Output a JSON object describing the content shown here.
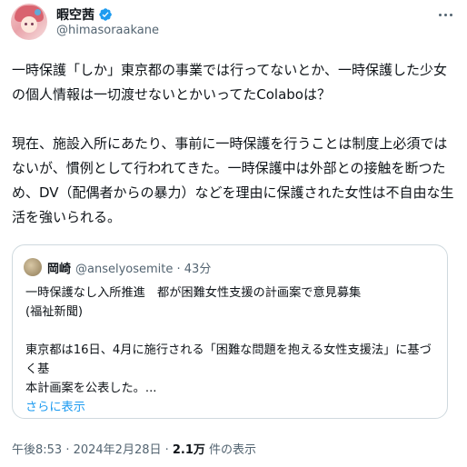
{
  "author": {
    "display_name": "暇空茜",
    "handle": "@himasoraakane"
  },
  "tweet": {
    "paragraph1": "一時保護「しか」東京都の事業では行ってないとか、一時保護した少女の個人情報は一切渡せないとかいってたColaboは？",
    "paragraph2": "現在、施設入所にあたり、事前に一時保護を行うことは制度上必須ではないが、慣例として行われてきた。一時保護中は外部との接触を断つため、DV（配偶者からの暴力）などを理由に保護された女性は不自由な生活を強いられる。"
  },
  "quote": {
    "name": "岡崎",
    "meta": "@anselyosemite · 43分",
    "line1": "一時保護なし入所推進　都が困難女性支援の計画案で意見募集",
    "line2": "(福祉新聞)",
    "line3": "東京都は16日、4月に施行される「困難な問題を抱える女性支援法」に基づく基",
    "line4": "本計画案を公表した。...",
    "show_more": "さらに表示"
  },
  "meta": {
    "time": "午後8:53 · 2024年2月28日 · ",
    "views_count": "2.1万",
    "views_label": " 件の表示"
  },
  "colors": {
    "accent": "#1d9bf0",
    "text": "#0f1419",
    "secondary": "#536471",
    "border": "#cfd9de"
  },
  "icons": [
    "verified-badge-icon",
    "more-options-icon"
  ]
}
